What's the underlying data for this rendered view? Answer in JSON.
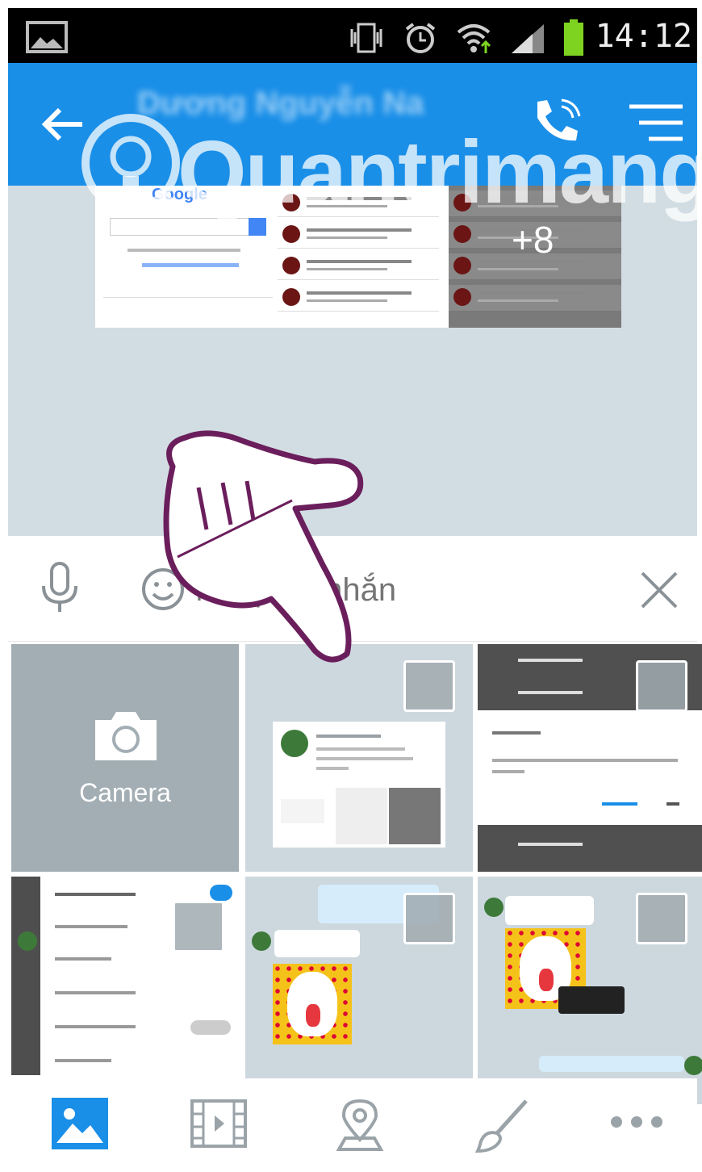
{
  "status_bar": {
    "time": "14:12",
    "icons": [
      "gallery-icon",
      "vibrate-icon",
      "alarm-icon",
      "wifi-icon",
      "signal-icon",
      "battery-icon"
    ]
  },
  "app_bar": {
    "title": "Dương Nguyễn Na",
    "icons": [
      "back-arrow-icon",
      "call-icon",
      "menu-icon"
    ],
    "color": "#1a8fe8"
  },
  "watermark": {
    "text": "Quantrimang"
  },
  "chat": {
    "shared_images_more": "+8",
    "google_logo": "Google"
  },
  "input_bar": {
    "placeholder": "Nhập tin nhắn",
    "icons": [
      "microphone-icon",
      "emoji-icon",
      "close-icon"
    ]
  },
  "gallery": {
    "camera_label": "Camera",
    "tiles": [
      {
        "kind": "camera"
      },
      {
        "kind": "screenshot-chat"
      },
      {
        "kind": "screenshot-dialog"
      },
      {
        "kind": "screenshot-settings"
      },
      {
        "kind": "screenshot-sticker"
      },
      {
        "kind": "screenshot-sticker-2"
      }
    ]
  },
  "bottom_toolbar": {
    "items": [
      "image-icon",
      "video-icon",
      "location-icon",
      "brush-icon",
      "more-icon"
    ],
    "active": "image-icon",
    "active_color": "#1a8fe8"
  }
}
